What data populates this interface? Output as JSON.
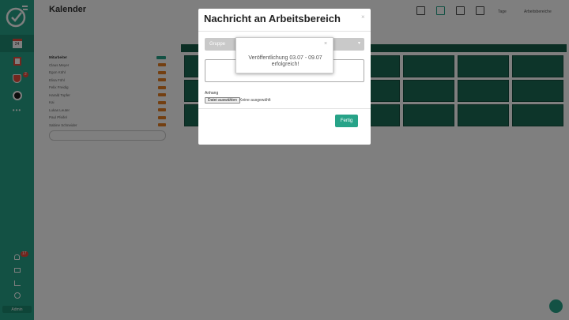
{
  "app": {
    "title": "Kalender"
  },
  "sidebar": {
    "date_day": "24",
    "badge_alerts": "2",
    "badge_notifications": "17",
    "admin_label": "Admin"
  },
  "header": {
    "tage_label": "Tage",
    "arbeitsbereich_label": "Arbeitsbereiche"
  },
  "staff": {
    "heading": "Mitarbeiter",
    "rows": [
      "Claus Meyer",
      "Egon Kühl",
      "Elisa Föhl",
      "Felix Freidig",
      "Harald Topfer",
      "Kai",
      "Lukas Leuter",
      "Paul Pfeifel",
      "Sabine Schneider"
    ]
  },
  "modal": {
    "title": "Nachricht an Arbeitsbereich",
    "close": "×",
    "group_label": "Gruppe",
    "attachment_label": "Anhang",
    "file_button": "Datei auswählen",
    "file_none": "Keine ausgewählt",
    "done_button": "Fertig"
  },
  "popup": {
    "close": "×",
    "line1": "Veröffentlichung 03.07 - 09.07",
    "line2": "erfolgreich!"
  },
  "colors": {
    "accent": "#27a388",
    "shift": "#1a6b55",
    "tag": "#e67e22"
  }
}
